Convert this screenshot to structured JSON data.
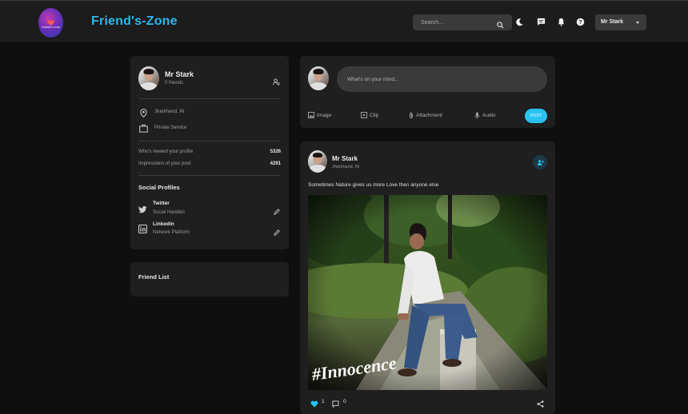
{
  "header": {
    "brand": "Friend's-Zone",
    "logo_text": "FRIEND'S ZONE",
    "search_placeholder": "Search...",
    "user_menu_label": "Mr Stark"
  },
  "profile_card": {
    "name": "Mr Stark",
    "friends": "0 friends",
    "location": "Jharkhand, IN",
    "occupation": "Private Service",
    "stats": [
      {
        "label": "Who's viewed your profile",
        "value": "5326"
      },
      {
        "label": "Impressions of your post",
        "value": "4291"
      }
    ],
    "social_title": "Social Profiles",
    "socials": [
      {
        "name": "Twitter",
        "sub": "Social Handles",
        "icon": "twitter-icon"
      },
      {
        "name": "Linkedin",
        "sub": "Network Platform",
        "icon": "linkedin-icon"
      }
    ]
  },
  "friend_list": {
    "title": "Friend List"
  },
  "composer": {
    "placeholder": "What's on your mind...",
    "tools": [
      "Image",
      "Clip",
      "Attachment",
      "Audio"
    ],
    "post_label": "POST"
  },
  "post": {
    "author": "Mr Stark",
    "location": "Jharkhand, IN",
    "text": "Sometimes Nature gives us more Love then anyone else",
    "photo_caption": "#Innocence",
    "likes": "1",
    "comments": "0"
  },
  "colors": {
    "accent": "#29b9ee",
    "background": "#0f0f0f",
    "card": "#1f1f1f",
    "topbar": "#1c1c1c"
  }
}
